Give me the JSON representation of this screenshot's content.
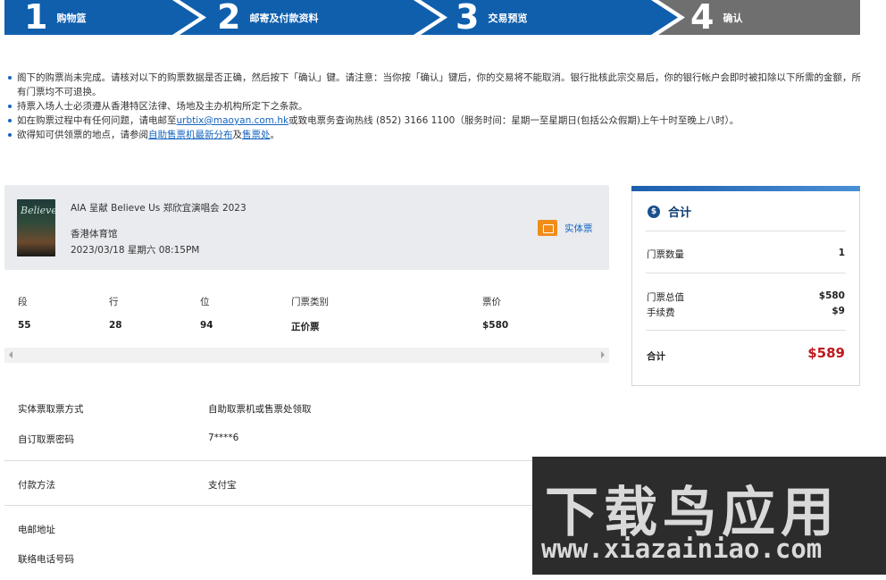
{
  "steps": [
    {
      "num": "1",
      "label": "购物篮"
    },
    {
      "num": "2",
      "label": "邮寄及付款资料"
    },
    {
      "num": "3",
      "label": "交易预览"
    },
    {
      "num": "4",
      "label": "确认"
    }
  ],
  "colors": {
    "step_active": "#0f5fad",
    "step_current": "#6f6f6f",
    "accent": "#1565c0",
    "total_red": "#c0171c"
  },
  "notes": {
    "n1": "阁下的购票尚未完成。请核对以下的购票数据是否正确，然后按下「确认」键。请注意：当你按「确认」键后，你的交易将不能取消。银行批核此宗交易后，你的银行帐户会即时被扣除以下所需的金额，所有门票均不可退换。",
    "n2": "持票入场人士必须遵从香港特区法律、场地及主办机构所定下之条款。",
    "n3_a": "如在购票过程中有任何问题，请电邮至",
    "n3_email": "urbtix@maoyan.com.hk",
    "n3_b": "或致电票务查询热线 (852) 3166 1100（服务时间：星期一至星期日(包括公众假期)上午十时至晚上八时）。",
    "n4_a": "欲得知可供领票的地点，请参阅",
    "n4_link1": "自助售票机最新分布",
    "n4_mid": "及",
    "n4_link2": "售票处",
    "n4_end": "。"
  },
  "event": {
    "poster_text": "Believe",
    "name": "AIA 呈献 Believe Us 郑欣宜演唱会 2023",
    "venue": "香港体育馆",
    "datetime": "2023/03/18 星期六 08:15PM",
    "ticket_type": "实体票",
    "ticket_icon": "ticket-icon"
  },
  "seat_table": {
    "headers": [
      "段",
      "行",
      "位",
      "门票类别",
      "票价"
    ],
    "row": [
      "55",
      "28",
      "94",
      "正价票",
      "$580"
    ]
  },
  "details": {
    "pickup_label": "实体票取票方式",
    "pickup_value": "自助取票机或售票处领取",
    "pin_label": "自订取票密码",
    "pin_value": "7****6",
    "payment_label": "付款方法",
    "payment_value": "支付宝",
    "address_label": "电邮地址",
    "phone_label": "联络电话号码"
  },
  "summary": {
    "title": "合计",
    "icon": "dollar-icon",
    "qty_label": "门票数量",
    "qty_value": "1",
    "total_tickets_label": "门票总值",
    "total_tickets_value": "$580",
    "fee_label": "手续费",
    "fee_value": "$9",
    "grand_label": "合计",
    "grand_value": "$589"
  },
  "watermark": {
    "main": "下载鸟应用",
    "url": "www.xiazainiao.com"
  }
}
